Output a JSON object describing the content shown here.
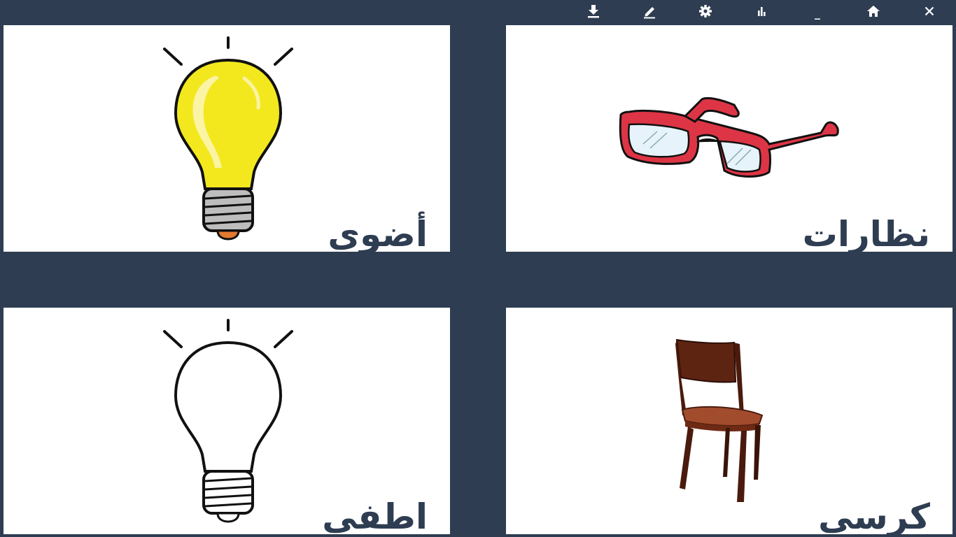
{
  "toolbar": {
    "buttons": [
      {
        "name": "download-button",
        "icon": "download-icon"
      },
      {
        "name": "edit-button",
        "icon": "pencil-icon"
      },
      {
        "name": "settings-button",
        "icon": "gear-icon"
      },
      {
        "name": "stats-button",
        "icon": "bar-chart-icon"
      },
      {
        "name": "minimize-button",
        "icon": "minimize-icon",
        "glyph": "_"
      },
      {
        "name": "home-button",
        "icon": "home-icon"
      },
      {
        "name": "close-button",
        "icon": "close-icon"
      }
    ],
    "icon_color": "#ffffff"
  },
  "cards": [
    {
      "id": "lamp-on",
      "label": "أضوي",
      "icon": "lightbulb-on-icon"
    },
    {
      "id": "glasses",
      "label": "نظارات",
      "icon": "glasses-icon"
    },
    {
      "id": "lamp-off",
      "label": "اطفي",
      "icon": "lightbulb-off-icon"
    },
    {
      "id": "chair",
      "label": "كرسي",
      "icon": "chair-icon"
    }
  ],
  "colors": {
    "background": "#2e3d51",
    "card": "#ffffff",
    "label": "#2e3d51",
    "bulb_yellow": "#f3e81e",
    "glasses_red": "#dd3545"
  }
}
